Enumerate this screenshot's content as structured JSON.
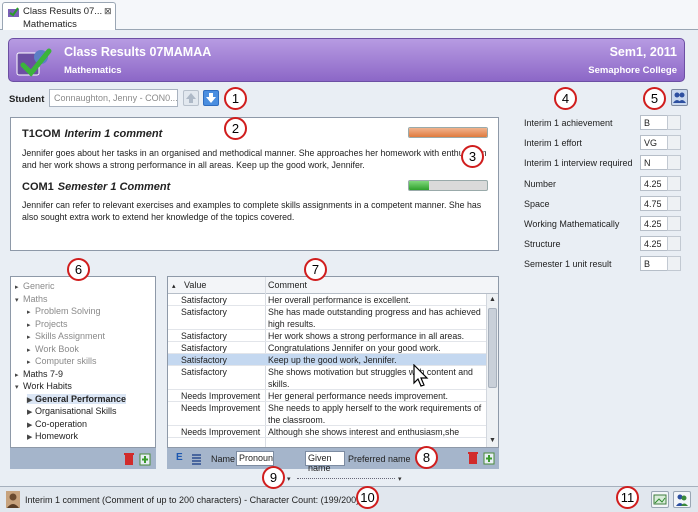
{
  "tab": {
    "title": "Class Results 07...",
    "subtitle": "Mathematics"
  },
  "header": {
    "title": "Class Results 07MAMAA",
    "subject": "Mathematics",
    "term": "Sem1, 2011",
    "school": "Semaphore College"
  },
  "student": {
    "label": "Student",
    "value": "Connaughton, Jenny - CON0..."
  },
  "comments": [
    {
      "code": "T1COM",
      "name": "Interim 1 comment",
      "progress": 1.0,
      "color": "orange",
      "text": "Jennifer goes about her tasks in an organised and methodical manner. She approaches her homework with enthusiasm and her work shows a strong performance in all areas. Keep up the good work, Jennifer."
    },
    {
      "code": "COM1",
      "name": "Semester 1 Comment",
      "progress": 0.25,
      "color": "green",
      "text": "Jennifer can refer to relevant exercises and examples to complete skills assignments in a competent manner. She has also sought extra work to extend her knowledge of the topics covered."
    }
  ],
  "results": [
    {
      "label": "Interim 1 achievement",
      "value": "B"
    },
    {
      "label": "Interim 1 effort",
      "value": "VG"
    },
    {
      "label": "Interim 1 interview required",
      "value": "N"
    },
    {
      "label": "Number",
      "value": "4.25"
    },
    {
      "label": "Space",
      "value": "4.75"
    },
    {
      "label": "Working Mathematically",
      "value": "4.25"
    },
    {
      "label": "Structure",
      "value": "4.25"
    },
    {
      "label": "Semester 1 unit result",
      "value": "B"
    }
  ],
  "tree": [
    {
      "label": "Generic",
      "level": 0,
      "tri": "▸",
      "grey": true
    },
    {
      "label": "Maths",
      "level": 0,
      "tri": "▾",
      "grey": true
    },
    {
      "label": "Problem Solving",
      "level": 1,
      "tri": "▸",
      "grey": true
    },
    {
      "label": "Projects",
      "level": 1,
      "tri": "▸",
      "grey": true
    },
    {
      "label": "Skills Assignment",
      "level": 1,
      "tri": "▸",
      "grey": true
    },
    {
      "label": "Work Book",
      "level": 1,
      "tri": "▸",
      "grey": true
    },
    {
      "label": "Computer skills",
      "level": 1,
      "tri": "▸",
      "grey": true
    },
    {
      "label": "Maths 7-9",
      "level": 0,
      "tri": "▸",
      "grey": false
    },
    {
      "label": "Work Habits",
      "level": 0,
      "tri": "▾",
      "grey": false
    },
    {
      "label": "General Performance",
      "level": 1,
      "tri": "▶",
      "grey": false,
      "selected": true
    },
    {
      "label": "Organisational Skills",
      "level": 1,
      "tri": "▶",
      "grey": false
    },
    {
      "label": "Co-operation",
      "level": 1,
      "tri": "▶",
      "grey": false
    },
    {
      "label": "Homework",
      "level": 1,
      "tri": "▶",
      "grey": false
    }
  ],
  "grid": {
    "columns": [
      "Value",
      "Comment"
    ],
    "rows": [
      {
        "value": "Satisfactory",
        "comment": "Her overall performance is excellent."
      },
      {
        "value": "Satisfactory",
        "comment": "She has made outstanding progress and has achieved high results."
      },
      {
        "value": "Satisfactory",
        "comment": "Her work shows a strong performance in all areas."
      },
      {
        "value": "Satisfactory",
        "comment": "Congratulations Jennifer on your good work."
      },
      {
        "value": "Satisfactory",
        "comment": "Keep up the good work, Jennifer.",
        "selected": true
      },
      {
        "value": "Satisfactory",
        "comment": "She shows motivation but struggles with content and skills."
      },
      {
        "value": "Needs Improvement",
        "comment": "Her general performance needs improvement."
      },
      {
        "value": "Needs Improvement",
        "comment": "She needs to apply herself to the work requirements of the classroom."
      },
      {
        "value": "Needs Improvement",
        "comment": "Although she shows interest and enthusiasm,she"
      }
    ]
  },
  "grid_footer": {
    "e": "E",
    "name_label": "Name",
    "pronoun": "Pronoun",
    "given_name": "Given name",
    "preferred": "Preferred name"
  },
  "status": {
    "text": "Interim 1 comment (Comment of up to 200 characters) - Character Count: (199/200)"
  },
  "callouts": [
    "1",
    "2",
    "3",
    "4",
    "5",
    "6",
    "7",
    "8",
    "9",
    "10",
    "11"
  ]
}
